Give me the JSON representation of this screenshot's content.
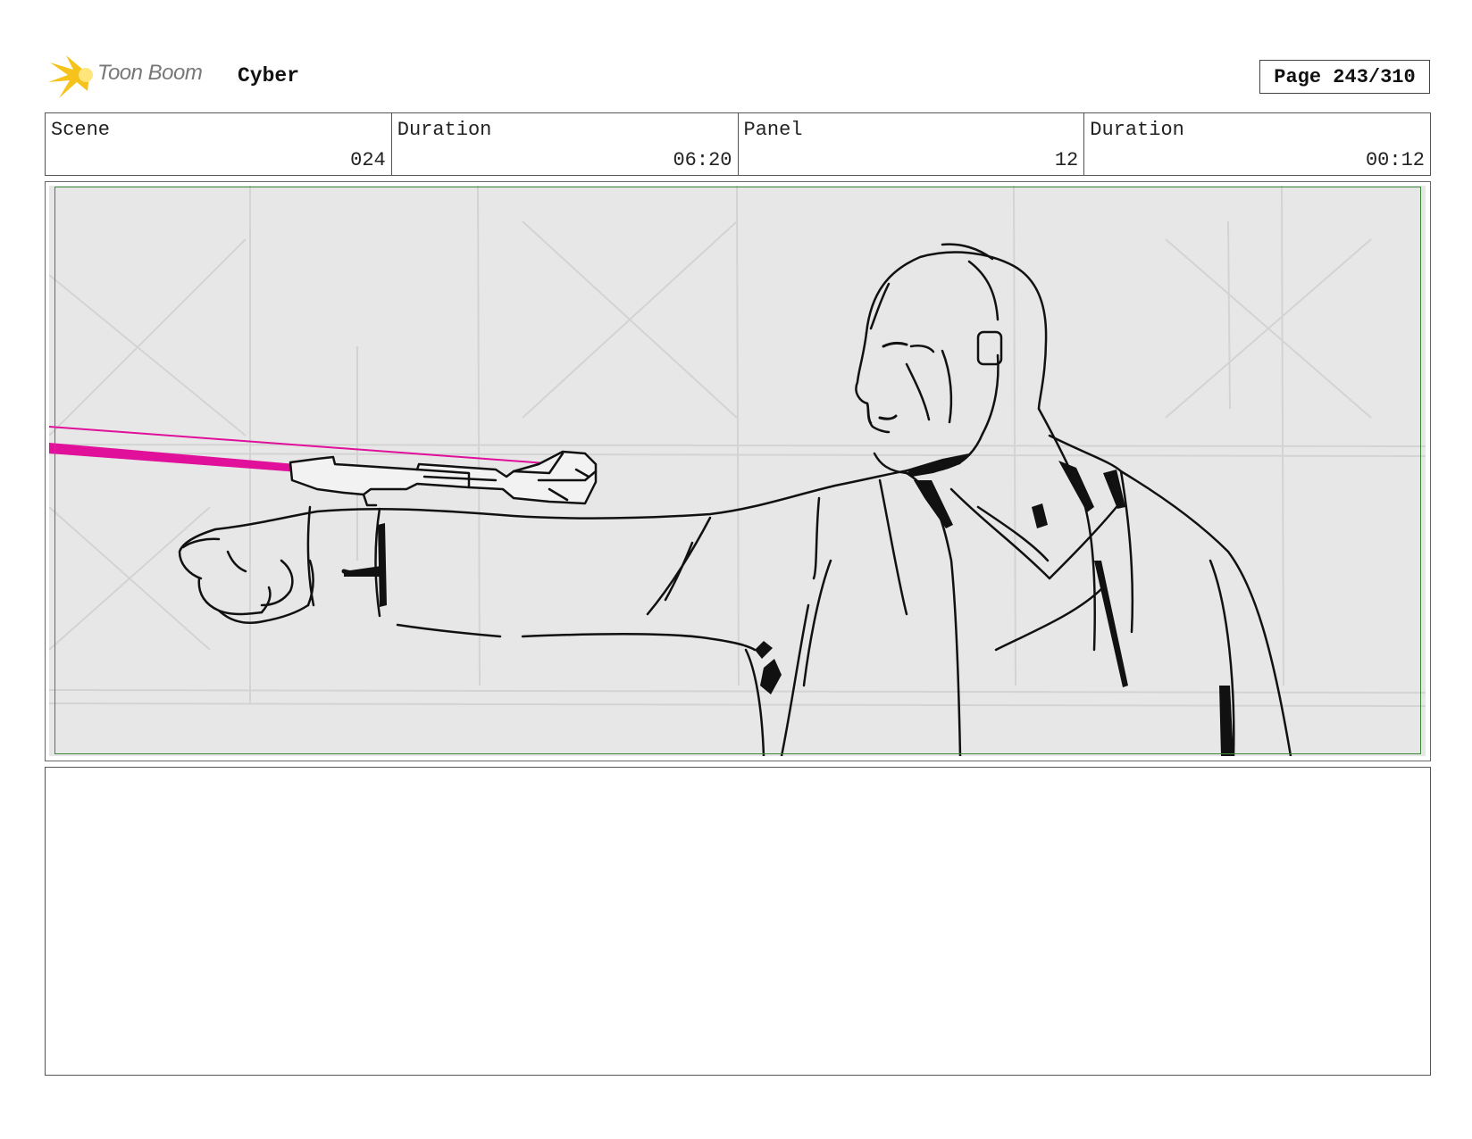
{
  "header": {
    "logo_text": "Toon Boom",
    "project_title": "Cyber",
    "page_label": "Page 243/310"
  },
  "info": {
    "scene_label": "Scene",
    "scene_value": "024",
    "scene_duration_label": "Duration",
    "scene_duration_value": "06:20",
    "panel_label": "Panel",
    "panel_value": "12",
    "panel_duration_label": "Duration",
    "panel_duration_value": "00:12"
  },
  "panel": {
    "background_color": "#e7e7e7",
    "safe_frame_color": "#3a8a3a",
    "laser_color": "#e0109a"
  },
  "notes": {
    "text": ""
  }
}
